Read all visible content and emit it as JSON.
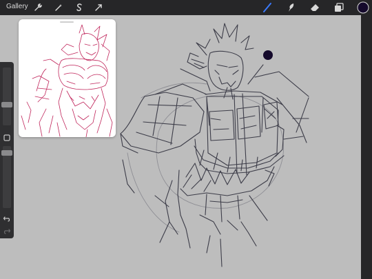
{
  "app": {
    "gallery_label": "Gallery"
  },
  "toolbar": {
    "left_tools": [
      "wrench-icon",
      "magic-wand-icon",
      "selection-s-icon",
      "transform-arrow-icon"
    ],
    "right_tools": [
      "brush-icon",
      "smudge-icon",
      "eraser-icon",
      "layers-icon"
    ],
    "active_tool": "brush-icon",
    "active_tool_color": "#3b7bff",
    "current_color": "#150a2c"
  },
  "sidebar": {
    "brush_size_level": 0.4,
    "opacity_level": 0.55,
    "modify_button": "square-icon",
    "undo": "undo-icon",
    "redo": "redo-icon"
  },
  "reference_window": {
    "line_color": "#c0245a"
  },
  "canvas": {
    "background_color": "#bdbdbd",
    "sketch_color": "#3c3c48"
  }
}
